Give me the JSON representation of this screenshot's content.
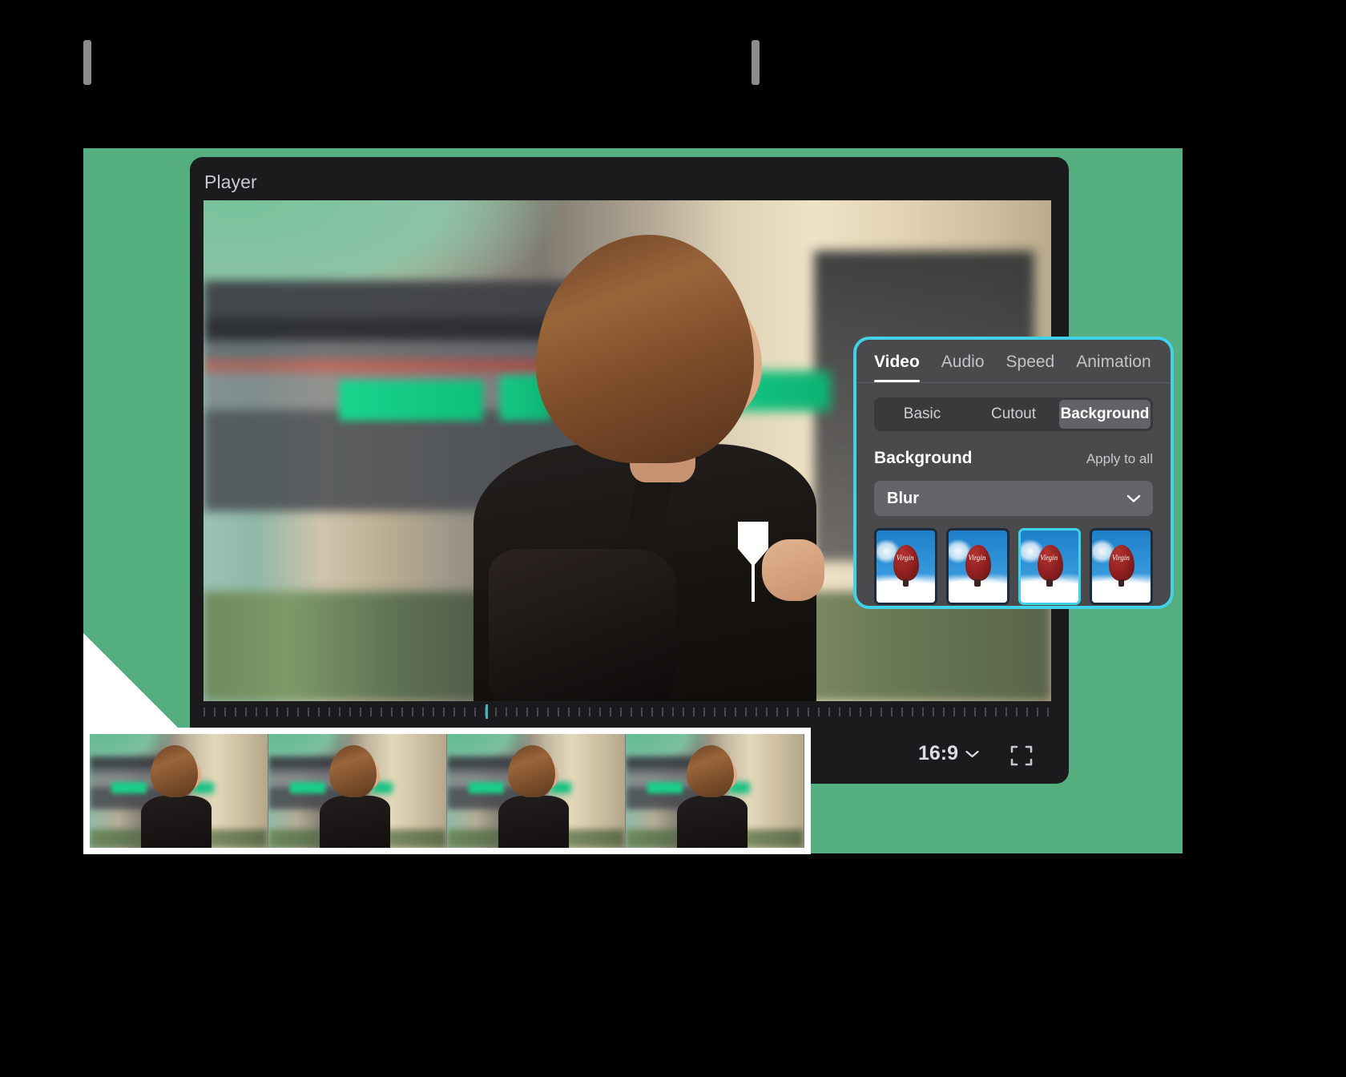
{
  "theme": {
    "green": "#55ae80",
    "cyan": "#3fd2e8",
    "panel_bg": "#4a4a4d",
    "window_bg": "#1b1b1e",
    "text": "#ffffff"
  },
  "player": {
    "title": "Player",
    "aspect_ratio_label": "16:9",
    "aspect_ratio_icon": "chevron-down-icon",
    "fullscreen_icon": "fullscreen-icon",
    "playhead_icon": "playhead-marker"
  },
  "settings_panel": {
    "tabs": [
      {
        "label": "Video",
        "active": true
      },
      {
        "label": "Audio",
        "active": false
      },
      {
        "label": "Speed",
        "active": false
      },
      {
        "label": "Animation",
        "active": false
      }
    ],
    "segments": [
      {
        "label": "Basic",
        "active": false
      },
      {
        "label": "Cutout",
        "active": false
      },
      {
        "label": "Background",
        "active": true
      }
    ],
    "section": {
      "title": "Background",
      "action": "Apply to all"
    },
    "dropdown": {
      "value": "Blur",
      "icon": "chevron-down-icon"
    },
    "thumbnails": [
      {
        "name": "balloon-thumb-1",
        "selected": false
      },
      {
        "name": "balloon-thumb-2",
        "selected": false
      },
      {
        "name": "balloon-thumb-3",
        "selected": true
      },
      {
        "name": "balloon-thumb-4",
        "selected": false
      }
    ],
    "thumbnail_logo": "Virgin"
  },
  "timeline": {
    "clip_count": 4,
    "left_handle": "trim-handle-left",
    "right_handle": "trim-handle-right"
  }
}
